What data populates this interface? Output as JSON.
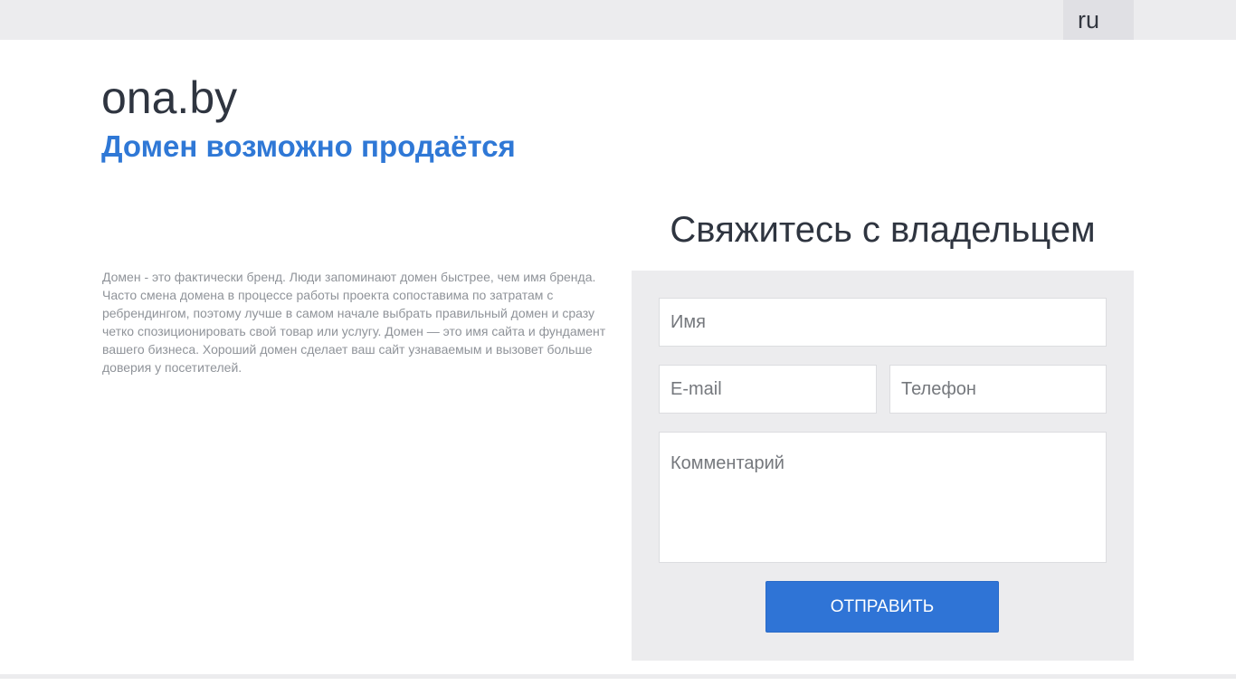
{
  "header": {
    "language": "ru"
  },
  "hero": {
    "domain": "ona.by",
    "subtitle": "Домен возможно продаётся"
  },
  "description": "Домен - это фактически бренд. Люди запоминают домен быстрее, чем имя бренда. Часто смена домена в процессе работы проекта сопоставима по затратам с ребрендингом, поэтому лучше в самом начале выбрать правильный домен и сразу четко спозиционировать свой товар или услугу. Домен — это имя сайта и фундамент вашего бизнеса. Хороший домен сделает ваш сайт узнаваемым и вызовет больше доверия у посетителей.",
  "contact": {
    "title": "Свяжитесь с владельцем",
    "name_placeholder": "Имя",
    "email_placeholder": "E-mail",
    "phone_placeholder": "Телефон",
    "comment_placeholder": "Комментарий",
    "submit_label": "Отправить"
  },
  "colors": {
    "accent": "#2f74d6",
    "panel": "#ececee",
    "text_dark": "#2f3540",
    "text_muted": "#8f9399"
  }
}
